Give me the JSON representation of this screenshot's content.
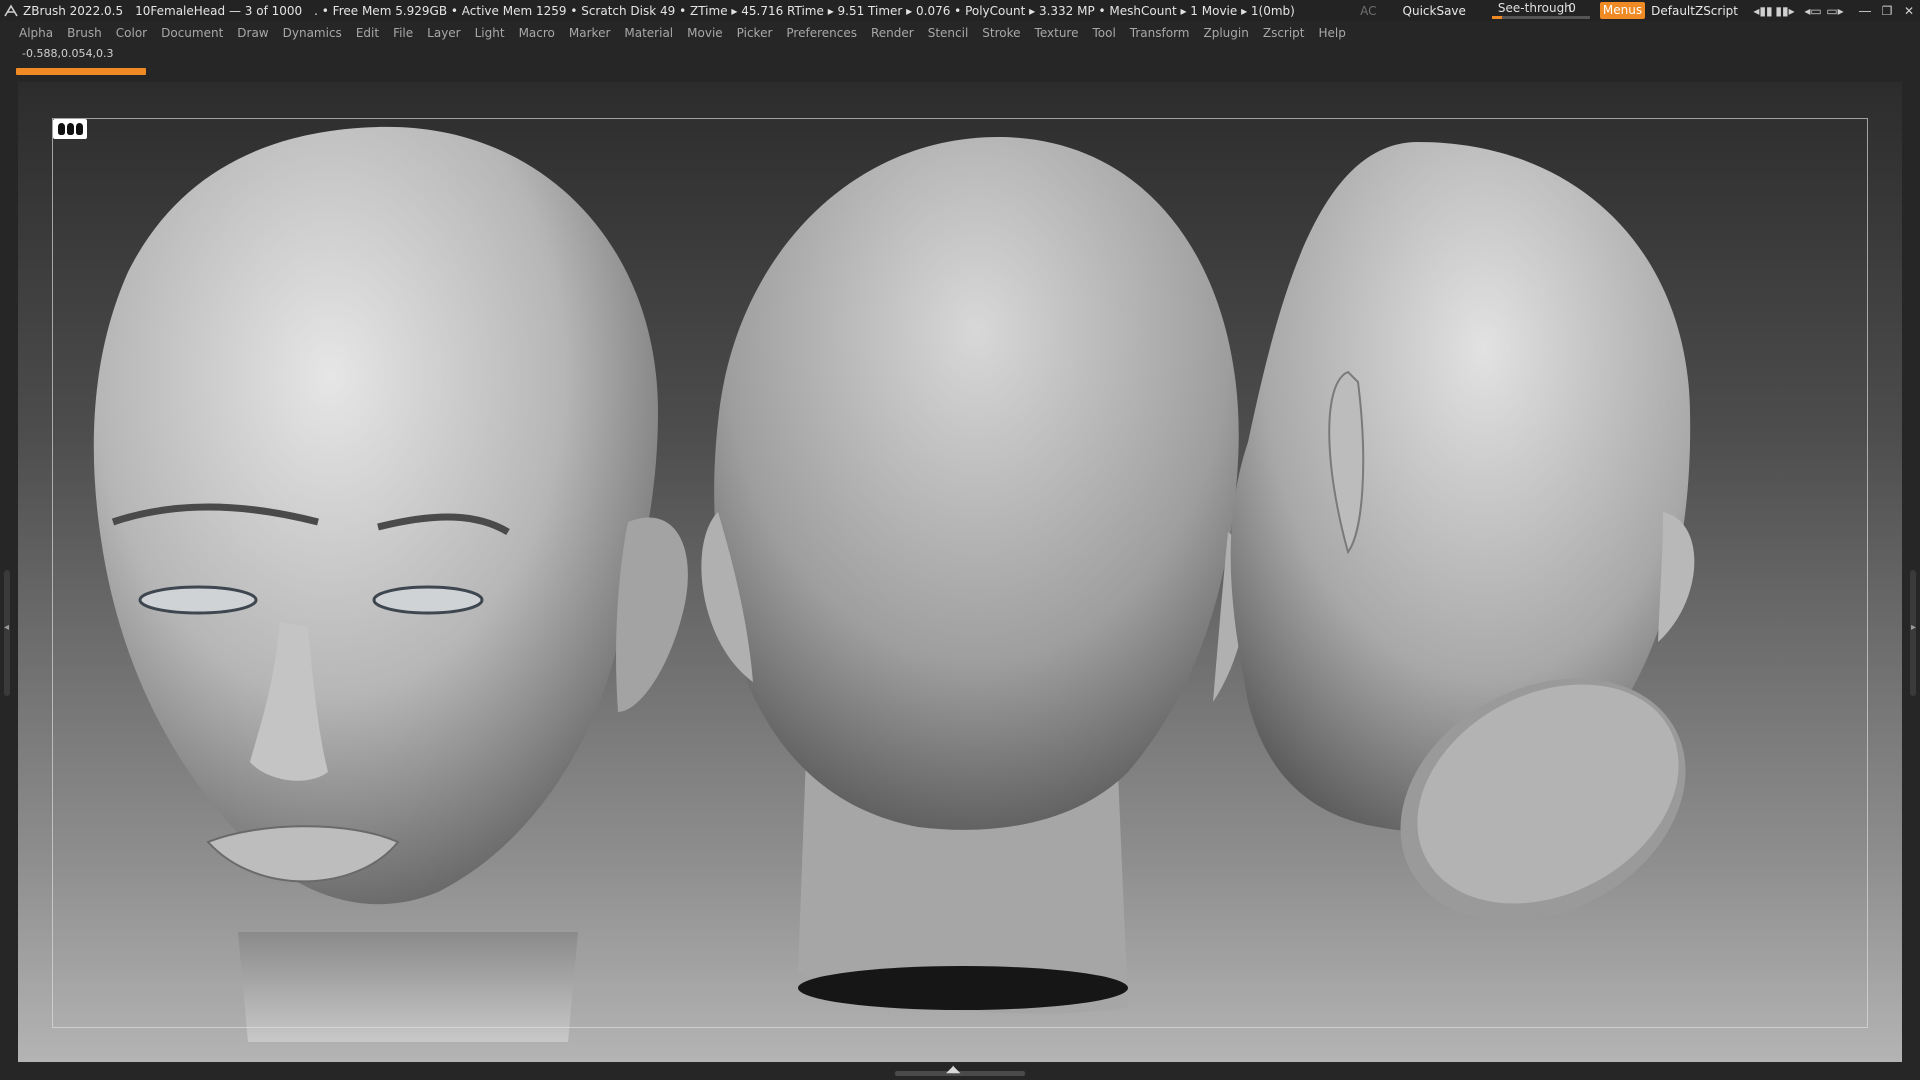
{
  "titlebar": {
    "app_title": "ZBrush 2022.0.5",
    "document": "10FemaleHead — 3 of 1000",
    "stats": ". • Free Mem 5.929GB • Active Mem 1259 • Scratch Disk 49 •  ZTime ▸ 45.716 RTime ▸ 9.51 Timer ▸ 0.076 • PolyCount ▸ 3.332 MP  • MeshCount ▸ 1  Movie ▸ 1(0mb)",
    "ac_label": "AC",
    "quicksave_label": "QuickSave",
    "seethrough_label": "See-through",
    "seethrough_value": "0",
    "seethrough_level": 0.1,
    "menus_label": "Menus",
    "zscript_label": "DefaultZScript",
    "accent_color": "#f08a24",
    "icons": [
      "ui-narrow-icon",
      "ui-wide-icon",
      "layout-icon",
      "dock-icon",
      "minimize-icon",
      "restore-icon",
      "close-icon"
    ]
  },
  "menubar": {
    "items": [
      "Alpha",
      "Brush",
      "Color",
      "Document",
      "Draw",
      "Dynamics",
      "Edit",
      "File",
      "Layer",
      "Light",
      "Macro",
      "Marker",
      "Material",
      "Movie",
      "Picker",
      "Preferences",
      "Render",
      "Stencil",
      "Stroke",
      "Texture",
      "Tool",
      "Transform",
      "Zplugin",
      "Zscript",
      "Help"
    ]
  },
  "status": {
    "coordinates": "-0.588,0.054,0.3",
    "progress": 1.0
  },
  "canvas": {
    "view_icon": "multi-view-icon",
    "models": [
      "head-front-view",
      "head-back-view",
      "head-bottom-view"
    ]
  }
}
